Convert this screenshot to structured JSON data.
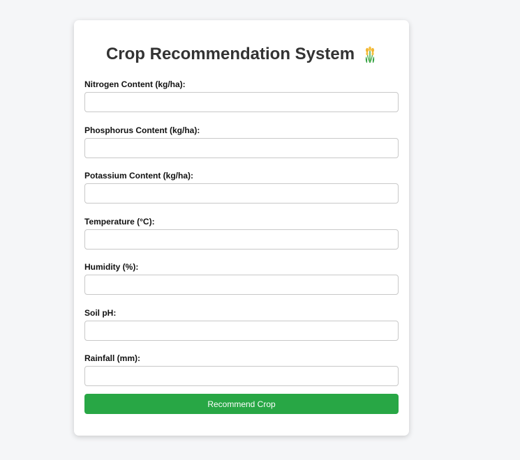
{
  "header": {
    "title": "Crop Recommendation System",
    "icon": "crop-sheaf-icon"
  },
  "form": {
    "fields": [
      {
        "label": "Nitrogen Content (kg/ha):",
        "value": "",
        "placeholder": ""
      },
      {
        "label": "Phosphorus Content (kg/ha):",
        "value": "",
        "placeholder": ""
      },
      {
        "label": "Potassium Content (kg/ha):",
        "value": "",
        "placeholder": ""
      },
      {
        "label": "Temperature (°C):",
        "value": "",
        "placeholder": ""
      },
      {
        "label": "Humidity (%):",
        "value": "",
        "placeholder": ""
      },
      {
        "label": "Soil pH:",
        "value": "",
        "placeholder": ""
      },
      {
        "label": "Rainfall (mm):",
        "value": "",
        "placeholder": ""
      }
    ],
    "submit_label": "Recommend Crop"
  },
  "colors": {
    "background": "#f5f6f8",
    "card": "#ffffff",
    "title_text": "#333333",
    "button": "#28a745",
    "button_text": "#ffffff",
    "input_border": "#c8c8c8"
  }
}
